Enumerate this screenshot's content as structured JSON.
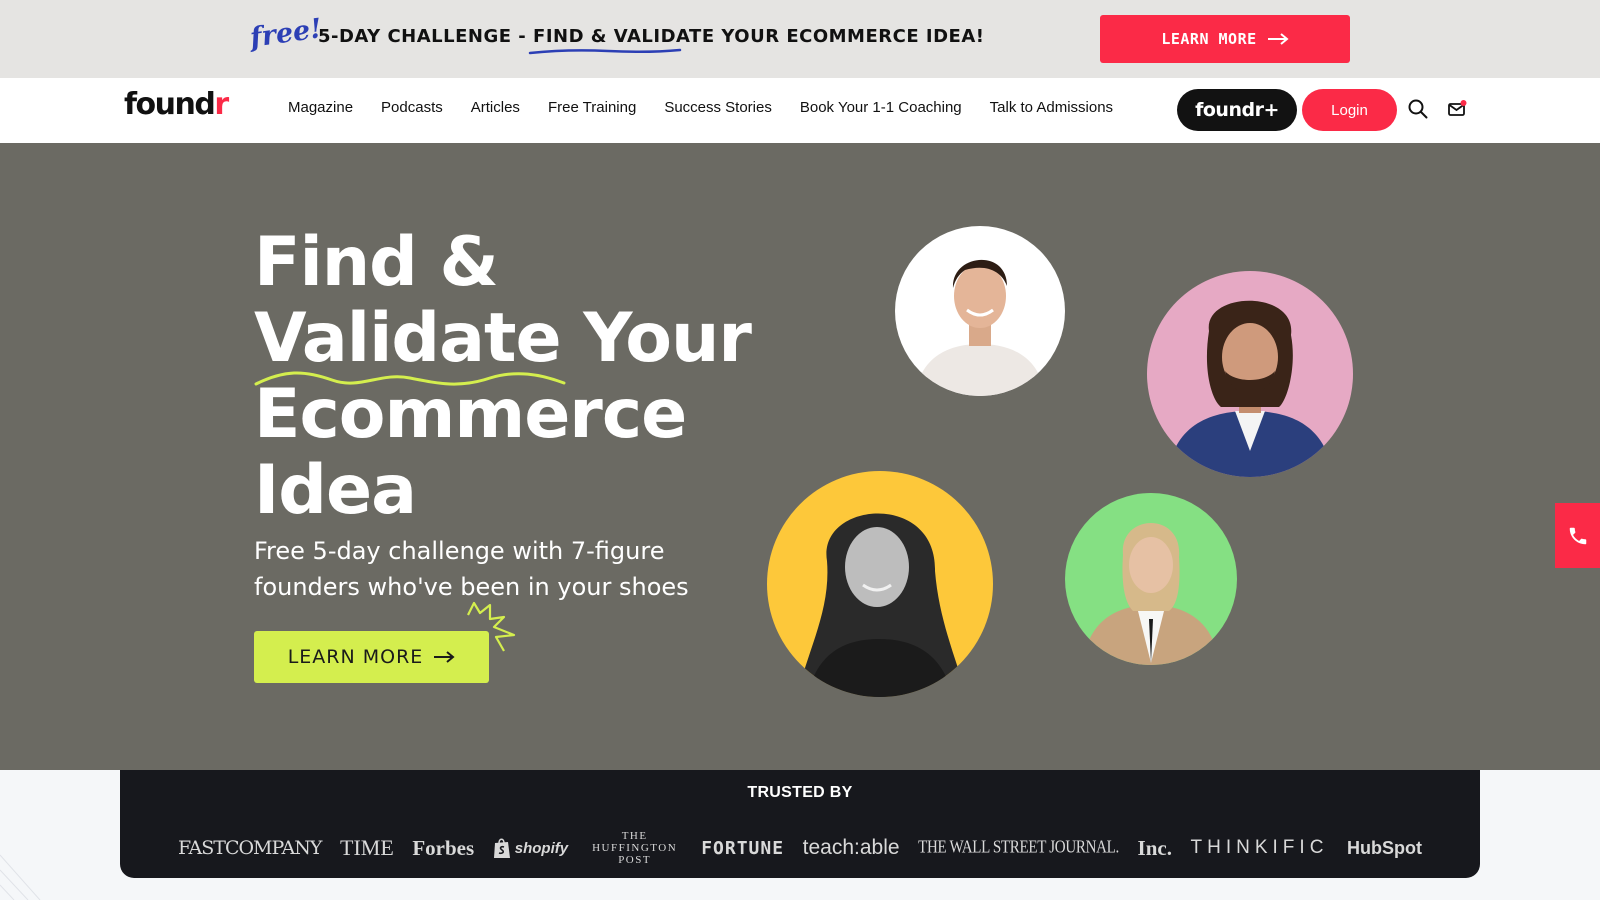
{
  "promo": {
    "free_label": "free!",
    "text_prefix": "5-DAY CHALLENGE - ",
    "text_highlight": "FIND & VALIDATE",
    "text_suffix": " YOUR ECOMMERCE IDEA!",
    "button_label": "LEARN MORE",
    "button_color": "#fb2a47"
  },
  "nav": {
    "logo_main": "found",
    "logo_accent": "r",
    "links": [
      "Magazine",
      "Podcasts",
      "Articles",
      "Free Training",
      "Success Stories",
      "Book Your 1-1 Coaching",
      "Talk to Admissions"
    ],
    "plus_label": "foundr+",
    "login_label": "Login",
    "icons": [
      "search-icon",
      "mail-icon"
    ]
  },
  "hero": {
    "title_lines": [
      "Find &",
      "Validate Your",
      "Ecommerce",
      "Idea"
    ],
    "subtitle": "Free 5-day challenge with 7-figure founders who've been in your shoes",
    "button_label": "LEARN MORE",
    "background": "#6b6a63",
    "accent": "#d4ee4e",
    "avatar_colors": [
      "#ffffff",
      "#e6a9c4",
      "#fdc83a",
      "#85e083"
    ]
  },
  "trusted": {
    "title": "TRUSTED BY",
    "logos": [
      "FASTCOMPANY",
      "TIME",
      "Forbes",
      "shopify",
      "THE HUFFINGTON POST",
      "FORTUNE",
      "teach:able",
      "THE WALL STREET JOURNAL.",
      "Inc.",
      "THINKIFIC",
      "HubSpot"
    ]
  }
}
